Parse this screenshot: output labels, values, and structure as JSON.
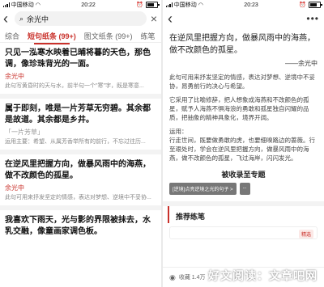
{
  "left": {
    "status": {
      "carrier": "中国移动",
      "time": "20:22",
      "battery": ""
    },
    "search": {
      "query": "余光中"
    },
    "tabs": [
      {
        "label": "综合"
      },
      {
        "label": "短句纸条 (99+)"
      },
      {
        "label": "图文纸条 (99+)"
      },
      {
        "label": "练笔"
      }
    ],
    "results": [
      {
        "title": "只见一泓寒水映着已晡将暮的天色，那色调，像珍珠背光的一面。",
        "author": "余光中",
        "snippet": "此句写黄昏时的天与水，前半句一个\"寒\"字，既是寒意..."
      },
      {
        "title": "属于即刻，唯是一片芳草无穷碧。其余都是故道。其余都是乡井。",
        "author": "「一片芳草」",
        "snippet": "运用主要：希望、从属芳香举所有的前行，不忘过往历..."
      },
      {
        "title": "在逆风里把握方向，做暴风雨中的海燕，做不改颜色的孤星。",
        "author": "余光中",
        "snippet": "此句可用来抒发坚定的情感，表达对梦想、逆境中不妥协..."
      },
      {
        "title": "我喜欢下雨天，光与影的界限被抹去，水乳交融，像童画家调色板。",
        "author": "",
        "snippet": ""
      }
    ]
  },
  "right": {
    "status": {
      "carrier": "中国移动",
      "time": "20:23"
    },
    "quote": "在逆风里把握方向，做暴风雨中的海燕，做不改颜色的孤星。",
    "quote_author": "——余光中",
    "paragraphs": [
      "此句可用来抒发坚定的情感，表达对梦想、逆境中不妥协，昂勇前行的决心与希望。",
      "它采用了比喻修辞，把人想象成海燕和不改颜色的孤星，赋予人海燕不惧海浪的勇敢和孤星独自闪耀的品质，把抽象的精神具象化，境界开阔。"
    ],
    "usage_label": "运用：",
    "usage_text": "行走世间，既要做勇敢的虎，也要细嗅路边的蔷薇。行至艰处时，学会在逆风里把握方向，做暴风雨中的海燕，做不改颜色的孤星，飞过海岸，闪闪发光。",
    "collected_title": "被收录至专题",
    "chips": [
      "[逆境]点亮逆境之光的句子 >",
      "..."
    ],
    "recommend_title": "推荐练笔",
    "card_badge": "精选",
    "bottom": {
      "views_icon": "eye-icon",
      "views": "收藏 1.4万"
    },
    "watermark": "好文阅读：文章吧网"
  }
}
